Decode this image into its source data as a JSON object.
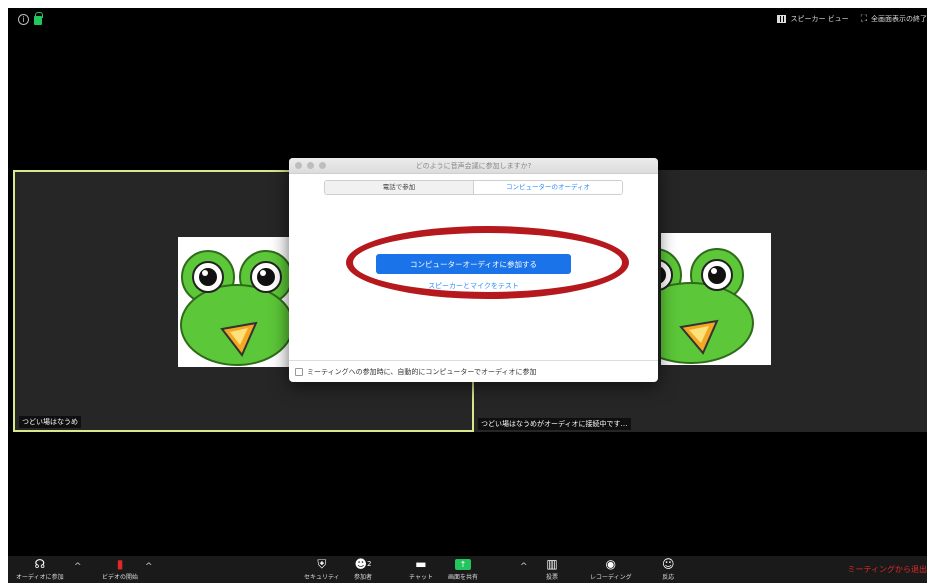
{
  "top_bar": {
    "info_icon": "info-icon",
    "lock_icon": "lock-icon",
    "speaker_view_label": "スピーカー ビュー",
    "exit_fullscreen_label": "全画面表示の終了"
  },
  "tiles": [
    {
      "name": "つどい場はなうめ"
    },
    {
      "name": "つどい場はなうめがオーディオに接続中です…"
    }
  ],
  "dialog": {
    "title": "どのように音声会議に参加しますか?",
    "tabs": [
      {
        "label": "電話で参加",
        "active": false
      },
      {
        "label": "コンピューターのオーディオ",
        "active": true
      }
    ],
    "join_button_label": "コンピューターオーディオに参加する",
    "test_link_label": "スピーカーとマイクをテスト",
    "auto_join_label": "ミーティングへの参加時に、自動的にコンピューターでオーディオに参加"
  },
  "toolbar": {
    "join_audio_label": "オーディオに参加",
    "start_video_label": "ビデオの開始",
    "security_label": "セキュリティ",
    "participants_label": "参加者",
    "participants_count": "2",
    "chat_label": "チャット",
    "share_screen_label": "画面を共有",
    "polls_label": "投票",
    "record_label": "レコーディング",
    "reactions_label": "反応",
    "leave_label": "ミーティングから退出"
  },
  "colors": {
    "accent_blue": "#1a73e8",
    "active_speaker_border": "#d8e88a",
    "annotation_red": "#b5191d",
    "leave_red": "#e02828"
  }
}
